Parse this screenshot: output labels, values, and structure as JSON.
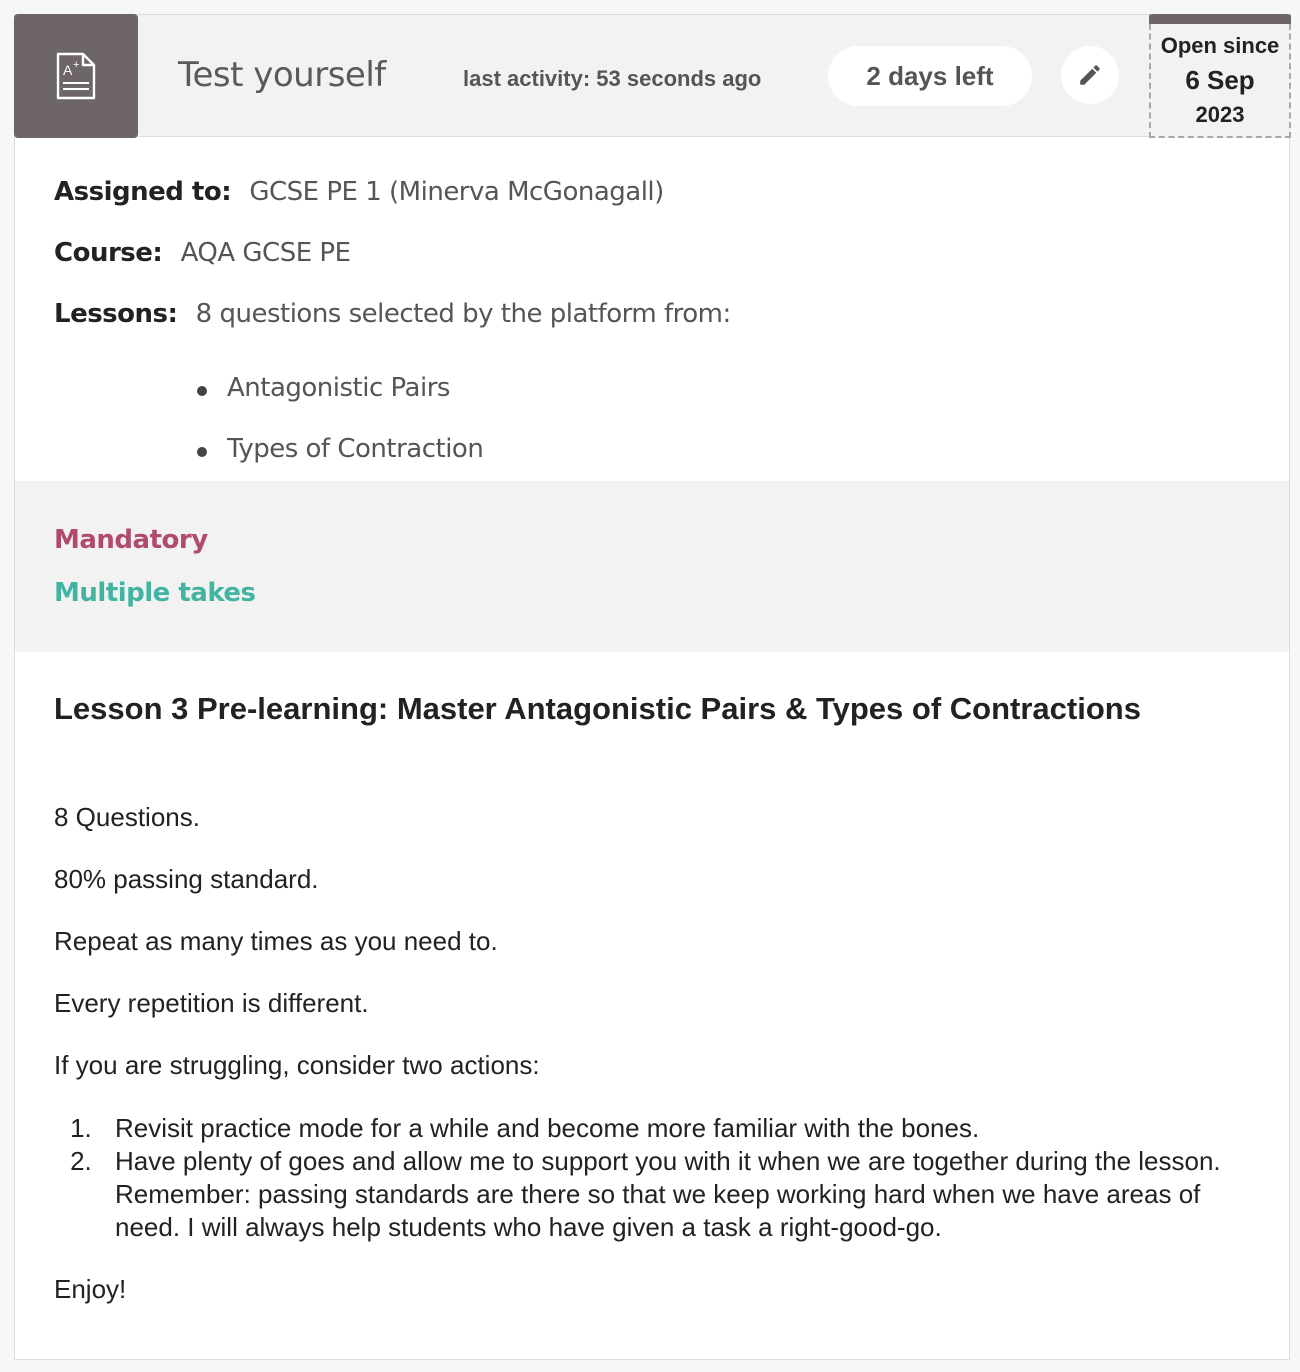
{
  "header": {
    "title": "Test yourself",
    "last_activity": "last activity: 53 seconds ago",
    "days_left": "2 days left",
    "open_since_label": "Open since",
    "open_since_day": "6 Sep",
    "open_since_year": "2023"
  },
  "meta": {
    "assigned_label": "Assigned to:",
    "assigned_value": "GCSE PE 1 (Minerva McGonagall)",
    "course_label": "Course:",
    "course_value": "AQA GCSE PE",
    "lessons_label": "Lessons:",
    "lessons_value": "8 questions selected by the platform from:",
    "lessons": [
      "Antagonistic Pairs",
      "Types of Contraction"
    ]
  },
  "tags": {
    "mandatory": "Mandatory",
    "multiple_takes": "Multiple takes"
  },
  "description": {
    "heading": "Lesson 3 Pre-learning: Master Antagonistic Pairs & Types of Contractions",
    "paragraphs": [
      "8 Questions.",
      "80% passing standard.",
      "Repeat as many times as you need to.",
      "Every repetition is different.",
      "If you are struggling, consider two actions:"
    ],
    "actions": [
      "Revisit practice mode for a while and become more familiar with the bones.",
      "Have plenty of goes and allow me to support you with it when we are together during the lesson. Remember: passing standards are there so that we keep working hard when we have areas of need. I will always help students who have given a task a right-good-go."
    ],
    "closing": "Enjoy!"
  },
  "colors": {
    "tile": "#6d6569",
    "mandatory": "#b04a6e",
    "multiple_takes": "#43b3a2"
  },
  "icons": {
    "type": "graded-document-icon",
    "edit": "pencil-icon"
  }
}
